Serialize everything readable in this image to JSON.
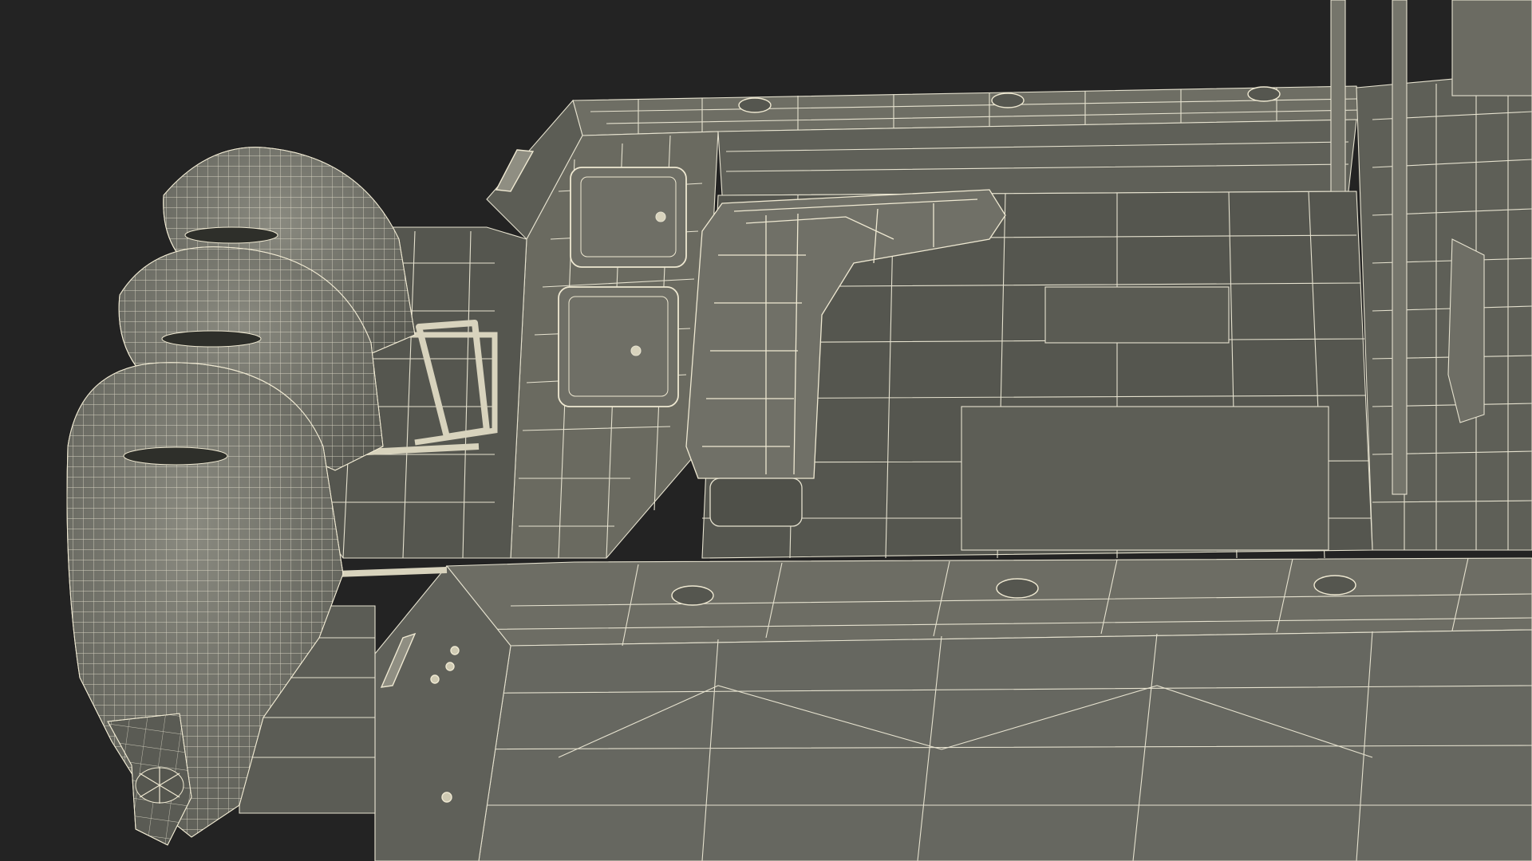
{
  "scene": {
    "subject": "boat-wireframe-render",
    "background_color": "#232323",
    "surface_color": "#6a6a60",
    "surface_dark_color": "#4e4f48",
    "wire_color": "#e6e2cf",
    "outboard_count": 3,
    "cup_holder_count": 6
  }
}
